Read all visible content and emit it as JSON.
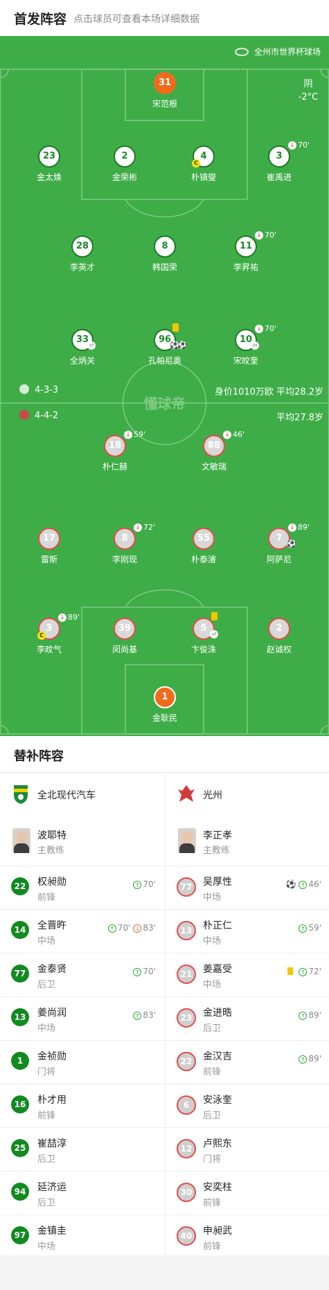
{
  "header": {
    "title": "首发阵容",
    "subtitle": "点击球员可查看本场详细数据"
  },
  "field": {
    "venue": "全州市世界杯球场",
    "weather": "阴",
    "temperature": "-2°C",
    "watermark": "懂球帝",
    "home_formation": "4-3-3",
    "away_formation": "4-4-2",
    "home_value": "身价1010万欧 平均28.2岁",
    "away_age": "平均27.8岁",
    "home_players": [
      {
        "num": "31",
        "name": "宋范根"
      },
      {
        "num": "23",
        "name": "金太焕"
      },
      {
        "num": "2",
        "name": "金荣彬"
      },
      {
        "num": "4",
        "name": "朴镇燮"
      },
      {
        "num": "3",
        "name": "崔禹进",
        "sub": "70'"
      },
      {
        "num": "28",
        "name": "李英才"
      },
      {
        "num": "8",
        "name": "韩国荣"
      },
      {
        "num": "11",
        "name": "李昇祐",
        "sub": "70'"
      },
      {
        "num": "33",
        "name": "全炳关"
      },
      {
        "num": "96",
        "name": "孔帕尼奥"
      },
      {
        "num": "10",
        "name": "宋旼奎",
        "sub": "70'"
      }
    ],
    "away_players": [
      {
        "num": "18",
        "name": "朴仁赫",
        "sub": "59'"
      },
      {
        "num": "88",
        "name": "文敏瑞",
        "sub": "46'"
      },
      {
        "num": "17",
        "name": "雷斯"
      },
      {
        "num": "8",
        "name": "李刚现",
        "sub": "72'"
      },
      {
        "num": "55",
        "name": "朴泰濬"
      },
      {
        "num": "7",
        "name": "阿萨尼",
        "sub": "89'"
      },
      {
        "num": "3",
        "name": "李旼气",
        "sub": "89'"
      },
      {
        "num": "39",
        "name": "闵尚基"
      },
      {
        "num": "5",
        "name": "卞俊洙"
      },
      {
        "num": "2",
        "name": "赵诚权"
      },
      {
        "num": "1",
        "name": "金耿民"
      }
    ]
  },
  "subs": {
    "title": "替补阵容",
    "home": {
      "team": "全北现代汽车",
      "coach": {
        "name": "波耶特",
        "role": "主教练"
      },
      "players": [
        {
          "num": "22",
          "name": "权昶勋",
          "pos": "前锋",
          "in": "70'"
        },
        {
          "num": "14",
          "name": "全晋旿",
          "pos": "中场",
          "in": "70'",
          "out": "83'"
        },
        {
          "num": "77",
          "name": "金泰贤",
          "pos": "后卫",
          "in": "70'"
        },
        {
          "num": "13",
          "name": "姜尚润",
          "pos": "中场",
          "in": "83'"
        },
        {
          "num": "1",
          "name": "金祯勋",
          "pos": "门将"
        },
        {
          "num": "16",
          "name": "朴才用",
          "pos": "前锋"
        },
        {
          "num": "25",
          "name": "崔喆淳",
          "pos": "后卫"
        },
        {
          "num": "94",
          "name": "延济运",
          "pos": "后卫"
        },
        {
          "num": "97",
          "name": "金镇圭",
          "pos": "中场"
        }
      ]
    },
    "away": {
      "team": "光州",
      "coach": {
        "name": "李正孝",
        "role": "主教练"
      },
      "players": [
        {
          "num": "77",
          "name": "吴厚性",
          "pos": "中场",
          "in": "46'"
        },
        {
          "num": "13",
          "name": "朴正仁",
          "pos": "中场",
          "in": "59'"
        },
        {
          "num": "21",
          "name": "姜嘉受",
          "pos": "中场",
          "in": "72'"
        },
        {
          "num": "23",
          "name": "金进晧",
          "pos": "后卫",
          "in": "89'"
        },
        {
          "num": "22",
          "name": "金汉吉",
          "pos": "前锋",
          "in": "89'"
        },
        {
          "num": "6",
          "name": "安泳奎",
          "pos": "后卫"
        },
        {
          "num": "12",
          "name": "卢熙东",
          "pos": "门将"
        },
        {
          "num": "30",
          "name": "安奕柱",
          "pos": "前锋"
        },
        {
          "num": "40",
          "name": "申昶武",
          "pos": "前锋"
        }
      ]
    }
  }
}
